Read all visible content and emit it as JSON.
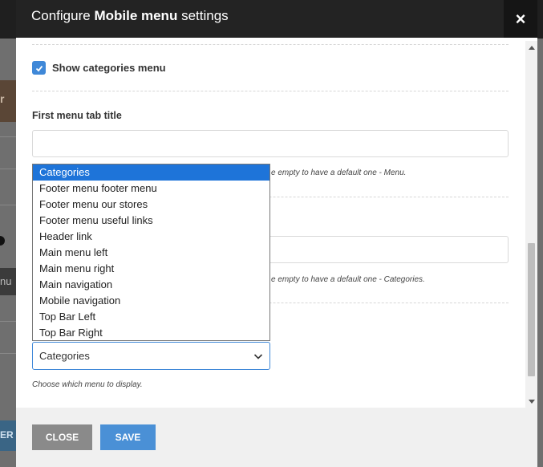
{
  "background": {
    "fragment_left_char": "r",
    "fragment_menu_text": "nu",
    "fragment_button_text": "ER"
  },
  "modal": {
    "title_prefix": "Configure ",
    "title_bold": "Mobile menu",
    "title_suffix": " settings",
    "close_icon": "×"
  },
  "form": {
    "show_categories": {
      "label": "Show categories menu",
      "checked": true
    },
    "first_tab": {
      "label": "First menu tab title",
      "value": "",
      "hint": "e empty to have a default one - Menu."
    },
    "second_tab": {
      "value": "",
      "hint": "e empty to have a default one - Categories."
    },
    "menu_select": {
      "selected": "Categories",
      "hint": "Choose which menu to display.",
      "options": [
        "Categories",
        "Footer menu footer menu",
        "Footer menu our stores",
        "Footer menu useful links",
        "Header link",
        "Main menu left",
        "Main menu right",
        "Main navigation",
        "Mobile navigation",
        "Top Bar Left",
        "Top Bar Right"
      ]
    }
  },
  "footer": {
    "close_label": "CLOSE",
    "save_label": "SAVE"
  },
  "colors": {
    "accent": "#3f88d8",
    "selected_option": "#1e74d9",
    "header_bg": "#232323"
  }
}
